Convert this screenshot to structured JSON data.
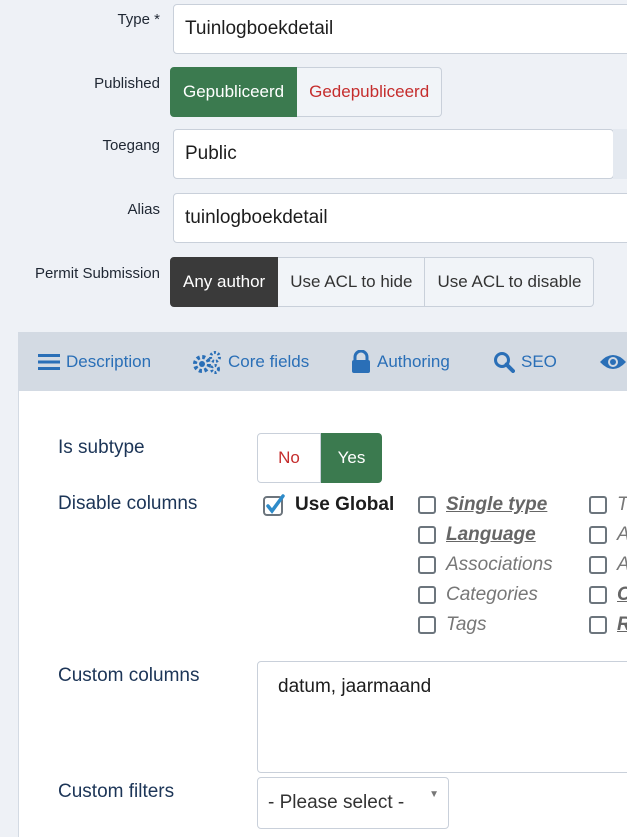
{
  "form": {
    "type_label": "Type *",
    "type_value": "Tuinlogboekdetail",
    "published_label": "Published",
    "published_options": [
      "Gepubliceerd",
      "Gedepubliceerd"
    ],
    "access_label": "Toegang",
    "access_value": "Public",
    "alias_label": "Alias",
    "alias_value": "tuinlogboekdetail",
    "permit_label": "Permit Submission",
    "permit_options": [
      "Any author",
      "Use ACL to hide",
      "Use ACL to disable"
    ]
  },
  "tabs": [
    {
      "label": "Description",
      "icon": "list-icon"
    },
    {
      "label": "Core fields",
      "icon": "gears-icon"
    },
    {
      "label": "Authoring",
      "icon": "lock-icon"
    },
    {
      "label": "SEO",
      "icon": "search-icon"
    },
    {
      "label": "",
      "icon": "eye-icon"
    }
  ],
  "panel": {
    "subtype_label": "Is subtype",
    "subtype_no": "No",
    "subtype_yes": "Yes",
    "disable_label": "Disable columns",
    "use_global": "Use Global",
    "columns_col1": [
      "Single type",
      "Language",
      "Associations",
      "Categories",
      "Tags"
    ],
    "columns_col2": [
      "T",
      "A",
      "A",
      "C",
      "R"
    ],
    "custom_columns_label": "Custom columns",
    "custom_columns_value": "datum, jaarmaand",
    "custom_filters_label": "Custom filters",
    "custom_filters_placeholder": "- Please select -"
  },
  "colors": {
    "active_green": "#3b7a4f",
    "danger_red": "#c52d2d",
    "dark_active": "#3a3a3a",
    "tab_blue": "#2a6fb7",
    "label_navy": "#1c3557"
  }
}
